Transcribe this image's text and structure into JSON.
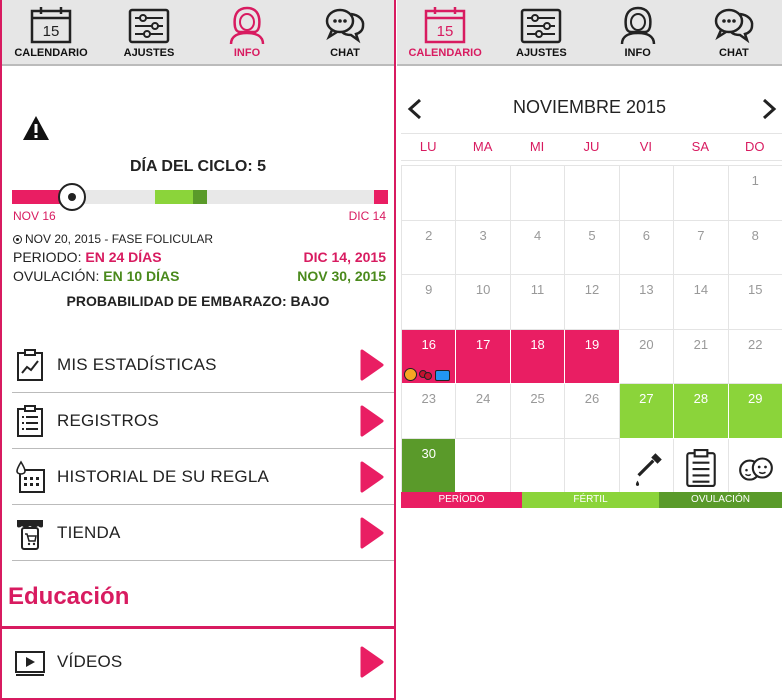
{
  "left": {
    "tabs": [
      {
        "label": "CALENDARIO",
        "icon": "calendar-icon",
        "day": "15"
      },
      {
        "label": "AJUSTES",
        "icon": "settings-sliders-icon"
      },
      {
        "label": "INFO",
        "icon": "woman-profile-icon",
        "active": true
      },
      {
        "label": "CHAT",
        "icon": "chat-bubbles-icon"
      }
    ],
    "cycle_title": "DÍA DEL CICLO: 5",
    "cycle_progress": 0.15,
    "timeline_start": "NOV 16",
    "timeline_end": "DIC 14",
    "phase_line": "NOV 20, 2015 - FASE FOLICULAR",
    "period_label": "PERIODO:",
    "period_value": "EN 24 DÍAS",
    "period_date": "DIC 14, 2015",
    "ovulation_label": "OVULACIÓN:",
    "ovulation_value": "EN 10 DÍAS",
    "ovulation_date": "NOV 30, 2015",
    "probability": "PROBABILIDAD DE EMBARAZO: BAJO",
    "menu": [
      {
        "label": "MIS ESTADÍSTICAS",
        "icon": "stats-clipboard-icon"
      },
      {
        "label": "REGISTROS",
        "icon": "list-clipboard-icon"
      },
      {
        "label": "HISTORIAL DE SU REGLA",
        "icon": "calendar-drop-icon"
      },
      {
        "label": "TIENDA",
        "icon": "store-phone-icon"
      }
    ],
    "education_heading": "Educación",
    "video_label": "VÍDEOS"
  },
  "right": {
    "tabs": [
      {
        "label": "CALENDARIO",
        "icon": "calendar-icon",
        "day": "15",
        "active": true
      },
      {
        "label": "AJUSTES",
        "icon": "settings-sliders-icon"
      },
      {
        "label": "INFO",
        "icon": "woman-profile-icon"
      },
      {
        "label": "CHAT",
        "icon": "chat-bubbles-icon"
      }
    ],
    "month_title": "NOVIEMBRE 2015",
    "weekdays": [
      "LU",
      "MA",
      "MI",
      "JU",
      "VI",
      "SA",
      "DO"
    ],
    "weeks": [
      [
        "",
        "",
        "",
        "",
        "",
        "",
        "1"
      ],
      [
        "2",
        "3",
        "4",
        "5",
        "6",
        "7",
        "8"
      ],
      [
        "9",
        "10",
        "11",
        "12",
        "13",
        "14",
        "15"
      ],
      [
        "16",
        "17",
        "18",
        "19",
        "20",
        "21",
        "22"
      ],
      [
        "23",
        "24",
        "25",
        "26",
        "27",
        "28",
        "29"
      ],
      [
        "30",
        "",
        "",
        "",
        "",
        "",
        ""
      ]
    ],
    "legend": [
      {
        "label": "PERÍODO",
        "color": "#e91e63"
      },
      {
        "label": "FÉRTIL",
        "color": "#8bd43a"
      },
      {
        "label": "OVULACIÓN",
        "color": "#5a9a2a"
      }
    ]
  },
  "colors": {
    "accent": "#d81b60",
    "period": "#e91e63",
    "fertile": "#8bd43a",
    "ovulation": "#5a9a2a"
  }
}
